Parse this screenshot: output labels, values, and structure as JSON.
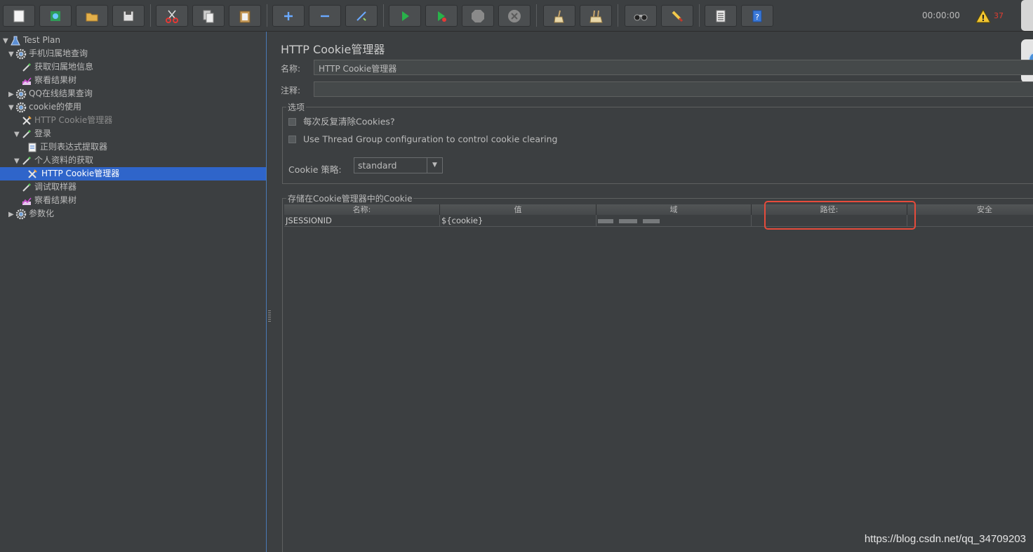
{
  "toolbar": {
    "buttons": [
      {
        "name": "new-button",
        "icon": "new-file-icon"
      },
      {
        "name": "templates-button",
        "icon": "templates-icon"
      },
      {
        "name": "open-button",
        "icon": "open-folder-icon"
      },
      {
        "name": "save-button",
        "icon": "save-icon"
      },
      {
        "name": "cut-button",
        "icon": "scissors-icon"
      },
      {
        "name": "copy-button",
        "icon": "copy-icon"
      },
      {
        "name": "paste-button",
        "icon": "clipboard-icon"
      },
      {
        "name": "expand-button",
        "icon": "plus-icon"
      },
      {
        "name": "collapse-button",
        "icon": "minus-icon"
      },
      {
        "name": "toggle-button",
        "icon": "wand-icon"
      },
      {
        "name": "start-button",
        "icon": "play-icon"
      },
      {
        "name": "start-no-pause-button",
        "icon": "play-no-pause-icon"
      },
      {
        "name": "stop-button",
        "icon": "stop-icon"
      },
      {
        "name": "shutdown-button",
        "icon": "shutdown-icon"
      },
      {
        "name": "clear-button",
        "icon": "broom-clear-icon"
      },
      {
        "name": "clear-all-button",
        "icon": "broom-clear-all-icon"
      },
      {
        "name": "search-button",
        "icon": "binoculars-icon"
      },
      {
        "name": "reset-search-button",
        "icon": "brush-icon"
      },
      {
        "name": "function-helper-button",
        "icon": "list-icon"
      },
      {
        "name": "help-button",
        "icon": "help-icon"
      }
    ],
    "elapsed_time": "00:00:00",
    "warning_count": "37"
  },
  "tree": {
    "nodes": [
      {
        "label": "Test Plan",
        "icon": "flask-icon",
        "arrow": "▼"
      },
      {
        "label": "手机归属地查询",
        "icon": "gear-icon",
        "arrow": "▼"
      },
      {
        "label": "获取归属地信息",
        "icon": "pipette-icon",
        "arrow": ""
      },
      {
        "label": "察看结果树",
        "icon": "graph-icon",
        "arrow": ""
      },
      {
        "label": "QQ在线结果查询",
        "icon": "gear-icon",
        "arrow": "▶"
      },
      {
        "label": "cookie的使用",
        "icon": "gear-icon",
        "arrow": "▼"
      },
      {
        "label": "HTTP Cookie管理器",
        "icon": "tools-icon",
        "arrow": ""
      },
      {
        "label": "登录",
        "icon": "pipette-icon",
        "arrow": "▼"
      },
      {
        "label": "正则表达式提取器",
        "icon": "document-icon",
        "arrow": ""
      },
      {
        "label": "个人资料的获取",
        "icon": "pipette-icon",
        "arrow": "▼"
      },
      {
        "label": "HTTP Cookie管理器",
        "icon": "tools-icon",
        "arrow": ""
      },
      {
        "label": "调试取样器",
        "icon": "pipette-icon",
        "arrow": ""
      },
      {
        "label": "察看结果树",
        "icon": "graph-icon",
        "arrow": ""
      },
      {
        "label": "参数化",
        "icon": "gear-icon",
        "arrow": "▶"
      }
    ]
  },
  "panel": {
    "title": "HTTP Cookie管理器",
    "name_label": "名称:",
    "name_value": "HTTP Cookie管理器",
    "comment_label": "注释:",
    "comment_value": "",
    "options": {
      "title": "选项",
      "clear_each_iteration": "每次反复清除Cookies?",
      "use_thread_group": "Use Thread Group configuration to control cookie clearing",
      "policy_label": "Cookie 策略:",
      "policy_value": "standard"
    },
    "cookies": {
      "title": "存储在Cookie管理器中的Cookie",
      "columns": [
        "名称:",
        "值",
        "域",
        "路径:",
        "安全"
      ],
      "rows": [
        {
          "name": "JSESSIONID",
          "value": "${cookie}",
          "domain": "",
          "path": ""
        }
      ]
    }
  },
  "watermark": "https://blog.csdn.net/qq_34709203",
  "colors": {
    "background": "#3c3f41",
    "selection": "#2f65ca",
    "highlight": "#e64b3b"
  }
}
